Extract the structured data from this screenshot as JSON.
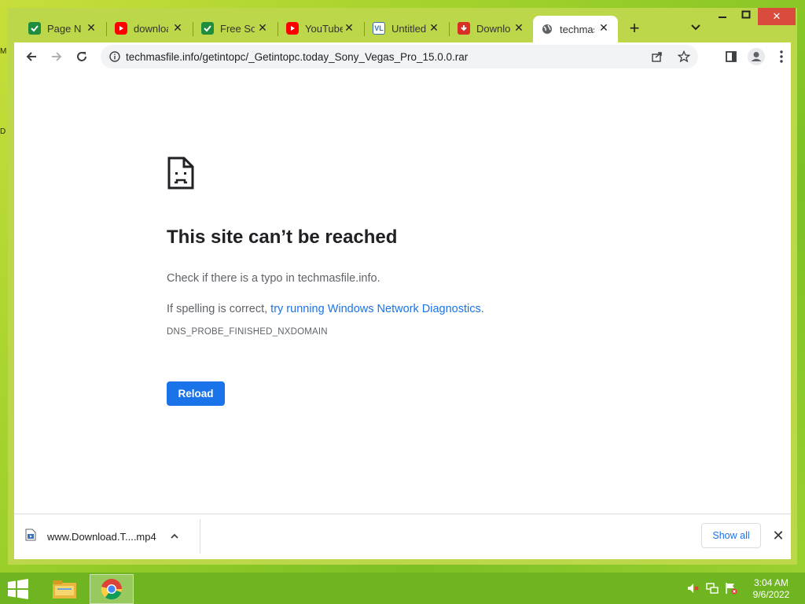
{
  "desktop": {
    "edge_letter_1": "M",
    "edge_letter_2": "D"
  },
  "tabs": [
    {
      "title": "Page Not Found",
      "icon": "green-check-icon",
      "color": "#1e8e3e"
    },
    {
      "title": "download",
      "icon": "youtube-icon",
      "color": "#ff0000"
    },
    {
      "title": "Free Software",
      "icon": "green-check-icon",
      "color": "#1e8e3e"
    },
    {
      "title": "YouTube",
      "icon": "youtube-icon",
      "color": "#ff0000"
    },
    {
      "title": "Untitled",
      "icon": "vl-icon",
      "color": "#3b6fb6"
    },
    {
      "title": "Download",
      "icon": "red-download-icon",
      "color": "#d93025"
    },
    {
      "title": "techmasfile",
      "icon": "globe-icon",
      "color": "#5f6368"
    }
  ],
  "toolbar": {
    "url": "techmasfile.info/getintopc/_Getintopc.today_Sony_Vegas_Pro_15.0.0.rar"
  },
  "error": {
    "title": "This site can’t be reached",
    "line1": "Check if there is a typo in techmasfile.info.",
    "line2_prefix": "If spelling is correct, ",
    "line2_link": "try running Windows Network Diagnostics",
    "line2_suffix": ".",
    "code": "DNS_PROBE_FINISHED_NXDOMAIN",
    "reload_label": "Reload"
  },
  "download_bar": {
    "file_name": "www.Download.T....mp4",
    "show_all_label": "Show all"
  },
  "taskbar": {
    "time": "3:04 AM",
    "date": "9/6/2022"
  },
  "colors": {
    "accent": "#1a73e8",
    "desktop": "#9bcf2a",
    "taskbar": "#6fb521"
  }
}
